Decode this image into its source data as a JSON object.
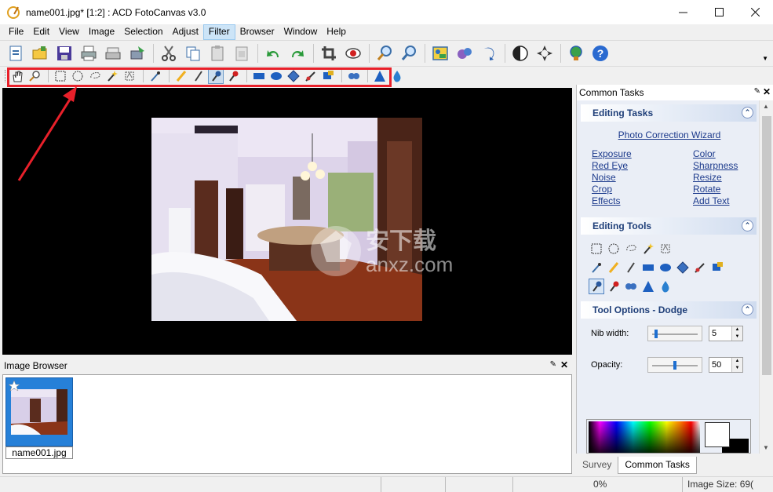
{
  "window": {
    "title": "name001.jpg* [1:2] : ACD FotoCanvas v3.0",
    "controls": [
      "minimize",
      "maximize",
      "close"
    ]
  },
  "menu": {
    "items": [
      "File",
      "Edit",
      "View",
      "Image",
      "Selection",
      "Adjust",
      "Filter",
      "Browser",
      "Window",
      "Help"
    ],
    "active": "Filter"
  },
  "main_toolbar": {
    "icons": [
      "new-icon",
      "open-icon",
      "save-icon",
      "print-icon",
      "scan-icon",
      "acquire-icon",
      "cut-icon",
      "copy-icon",
      "paste-icon",
      "paste-new-icon",
      "undo-icon",
      "redo-icon",
      "crop-icon",
      "red-eye-icon",
      "zoom-in-icon",
      "zoom-out-icon",
      "photo-gallery-icon",
      "share-icon",
      "rotate-icon",
      "contrast-icon",
      "move-icon",
      "web-icon",
      "help-icon"
    ]
  },
  "tools_toolbar": {
    "icons": [
      "hand-icon",
      "zoom-tool-icon",
      "rect-select-icon",
      "ellipse-select-icon",
      "lasso-select-icon",
      "magic-wand-icon",
      "freehand-select-icon",
      "eyedropper-icon",
      "pencil-icon",
      "brush-icon",
      "dodge-icon",
      "burn-icon",
      "rectangle-icon",
      "ellipse-icon",
      "sharpen-icon",
      "smudge-icon",
      "clone-icon",
      "red-eye-tool-icon",
      "triangle-icon",
      "blur-drop-icon"
    ],
    "pressed": "dodge-icon"
  },
  "image_browser": {
    "title": "Image Browser",
    "thumbnail_label": "name001.jpg"
  },
  "common_tasks": {
    "title": "Common Tasks",
    "editing_tasks": {
      "title": "Editing Tasks",
      "wizard_link": "Photo Correction Wizard",
      "left_links": [
        "Exposure",
        "Red Eye",
        "Noise",
        "Crop",
        "Effects"
      ],
      "right_links": [
        "Color",
        "Sharpness",
        "Resize",
        "Rotate",
        "Add Text"
      ]
    },
    "editing_tools": {
      "title": "Editing Tools"
    },
    "tool_options": {
      "title": "Tool Options - Dodge",
      "nib_width_label": "Nib width:",
      "nib_width_value": "5",
      "nib_width_level": 0.05,
      "opacity_label": "Opacity:",
      "opacity_value": "50",
      "opacity_level": 0.5
    }
  },
  "panel_tabs": [
    "Survey",
    "Common Tasks"
  ],
  "panel_tab_active": "Common Tasks",
  "status": {
    "progress": "0%",
    "image_size": "Image Size: 69("
  },
  "watermark": {
    "text": "安下载",
    "sub": "anxz.com"
  },
  "colors": {
    "accent_red": "#e8202a",
    "link_blue": "#1c3a8c",
    "section_title": "#1e3e78",
    "selection_blue": "#2680d8"
  }
}
